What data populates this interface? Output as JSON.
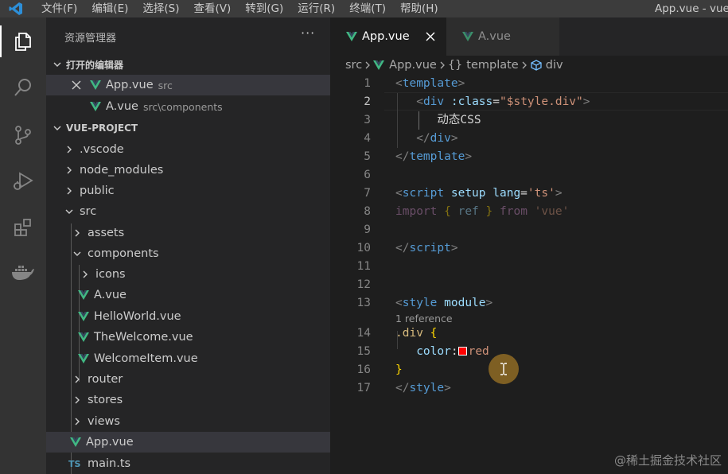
{
  "window": {
    "title": "App.vue - vue-"
  },
  "menu": {
    "items": [
      "文件(F)",
      "编辑(E)",
      "选择(S)",
      "查看(V)",
      "转到(G)",
      "运行(R)",
      "终端(T)",
      "帮助(H)"
    ]
  },
  "activity_bar": {
    "icons": [
      "files-icon",
      "search-icon",
      "source-control-icon",
      "run-debug-icon",
      "extensions-icon",
      "docker-icon"
    ]
  },
  "explorer": {
    "title": "资源管理器",
    "more": "···",
    "open_editors": {
      "label": "打开的编辑器",
      "items": [
        {
          "name": "App.vue",
          "path": "src"
        },
        {
          "name": "A.vue",
          "path": "src\\components"
        }
      ]
    },
    "project": {
      "label": "VUE-PROJECT",
      "tree": [
        {
          "label": ".vscode",
          "kind": "folder"
        },
        {
          "label": "node_modules",
          "kind": "folder"
        },
        {
          "label": "public",
          "kind": "folder"
        },
        {
          "label": "src",
          "kind": "folder-open"
        },
        {
          "label": "assets",
          "kind": "folder"
        },
        {
          "label": "components",
          "kind": "folder-open"
        },
        {
          "label": "icons",
          "kind": "folder"
        },
        {
          "label": "A.vue",
          "kind": "vue"
        },
        {
          "label": "HelloWorld.vue",
          "kind": "vue"
        },
        {
          "label": "TheWelcome.vue",
          "kind": "vue"
        },
        {
          "label": "WelcomeItem.vue",
          "kind": "vue"
        },
        {
          "label": "router",
          "kind": "folder"
        },
        {
          "label": "stores",
          "kind": "folder"
        },
        {
          "label": "views",
          "kind": "folder"
        },
        {
          "label": "App.vue",
          "kind": "vue"
        },
        {
          "label": "main.ts",
          "kind": "ts"
        }
      ]
    }
  },
  "tabs": [
    {
      "label": "App.vue",
      "active": true
    },
    {
      "label": "A.vue",
      "active": false
    }
  ],
  "breadcrumb": {
    "folder": "src",
    "file": "App.vue",
    "braces": "{}",
    "section": "template",
    "element": "div"
  },
  "editor": {
    "current_line": 2,
    "line_numbers": [
      "1",
      "2",
      "3",
      "4",
      "5",
      "6",
      "7",
      "8",
      "9",
      "10",
      "11",
      "12",
      "13",
      "14",
      "15",
      "16",
      "17"
    ],
    "tokens": {
      "lt": "<",
      "gt": ">",
      "lt_slash": "</",
      "eq": "=",
      "template": "template",
      "div": "div",
      "script": "script",
      "style": "style",
      "class_attr": ":class",
      "class_value": "\"$style.div\"",
      "text_dynamic_css": "动态CSS",
      "setup": "setup",
      "lang": "lang",
      "lang_value": "'ts'",
      "import": "import",
      "brace_open": "{",
      "ref": "ref",
      "brace_close": "}",
      "from": "from",
      "vue_str": "'vue'",
      "module": "module",
      "selector": ".div",
      "property": "color",
      "colon": ":",
      "value": "red"
    },
    "codelens": "1 reference",
    "color_swatch": "#ff0000"
  },
  "watermark": "@稀土掘金技术社区",
  "colors": {
    "vue_green": "#41b883",
    "ts_blue": "#519aba",
    "tag_blue": "#569cd6",
    "attr": "#9cdcfe",
    "string": "#ce9178"
  }
}
